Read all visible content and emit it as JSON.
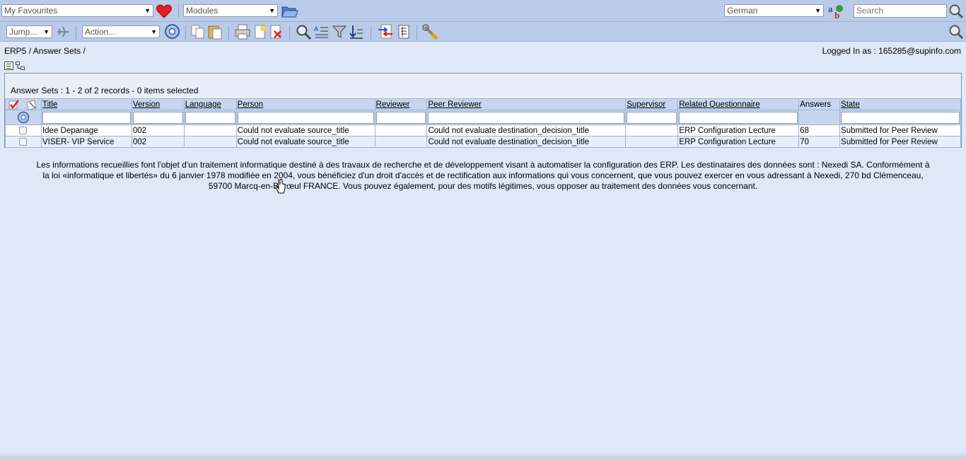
{
  "topbar": {
    "favourites_select": "My Favourites",
    "modules_select": "Modules",
    "language_select": "German",
    "search_placeholder": "Search"
  },
  "toolbar": {
    "jump_select": "Jump...",
    "action_select": "Action..."
  },
  "breadcrumb": {
    "root": "ERP5",
    "separator": " / ",
    "current": "Answer Sets",
    "trailing": " /"
  },
  "user": {
    "logged_in_text": "Logged In as : 165285@supinfo.com"
  },
  "listbox": {
    "title": "Answer Sets",
    "records_text": " :  1 - 2 of 2 records - 0 items selected",
    "columns": [
      "Title",
      "Version",
      "Language",
      "Person",
      "Reviewer",
      "Peer Reviewer",
      "Supervisor",
      "Related Questionnaire",
      "Answers",
      "State"
    ],
    "rows": [
      {
        "title": "Idee Depanage",
        "version": "002",
        "language": "",
        "person": "Could not evaluate source_title",
        "reviewer": "",
        "peer_reviewer": "Could not evaluate destination_decision_title",
        "supervisor": "",
        "related_questionnaire": "ERP Configuration Lecture",
        "answers": "68",
        "state": "Submitted for Peer Review"
      },
      {
        "title": "VISER- VIP Service",
        "version": "002",
        "language": "",
        "person": "Could not evaluate source_title",
        "reviewer": "",
        "peer_reviewer": "Could not evaluate destination_decision_title",
        "supervisor": "",
        "related_questionnaire": "ERP Configuration Lecture",
        "answers": "70",
        "state": "Submitted for Peer Review"
      }
    ]
  },
  "legal_notice": {
    "line1": "Les informations recueillies font l'objet d'un traitement informatique destiné à des travaux de recherche et de développement visant à automatiser la configuration des ERP. Les destinataires des données sont : Nexedi SA. Conformément à",
    "line2": "la loi «informatique et libertés» du 6 janvier 1978 modifiée en 2004, vous bénéficiez d'un droit d'accès et de rectification aux informations qui vous concernent, que vous pouvez exercer en vous adressant à Nexedi, 270 bd Clémenceau,",
    "line3": "59700 Marcq-en-Barœul FRANCE. Vous pouvez également, pour des motifs légitimes, vous opposer au traitement des données vous concernant."
  },
  "colors": {
    "toolbar_bg": "#b9cbe8",
    "page_bg": "#dfe8f6",
    "header_cell_bg": "#c7d6ee",
    "heart_red": "#e02020"
  },
  "icons": [
    "heart-icon",
    "folder-open-icon",
    "language-icon",
    "search-icon",
    "jump-icon",
    "action-run-icon",
    "copy-icon",
    "paste-icon",
    "print-icon",
    "new-document-icon",
    "delete-icon",
    "find-icon",
    "sort-icon",
    "filter-icon",
    "sort-descending-icon",
    "import-export-icon",
    "report-icon",
    "configure-icon",
    "zoom-icon",
    "check-all-icon",
    "uncheck-all-icon",
    "refresh-filter-icon",
    "list-mode-icon",
    "tree-mode-icon"
  ]
}
